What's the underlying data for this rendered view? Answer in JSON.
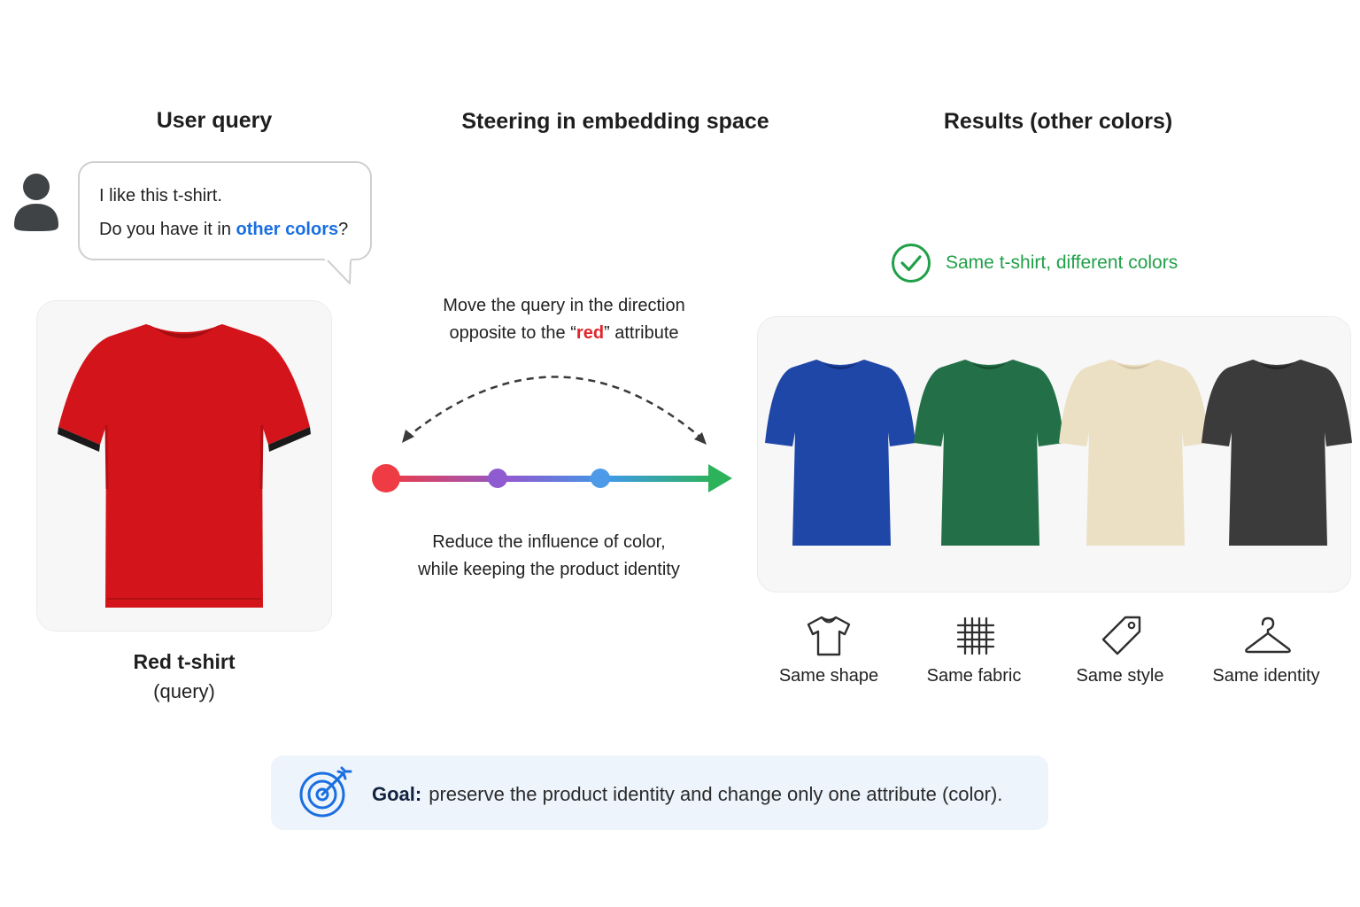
{
  "headers": {
    "query": "User query",
    "steering": "Steering in embedding space",
    "results": "Results (other colors)"
  },
  "bubble": {
    "line1": "I like this t-shirt.",
    "line2_prefix": "Do you have it in ",
    "line2_highlight": "other colors",
    "line2_suffix": "?"
  },
  "query_caption": {
    "title": "Red t-shirt",
    "subtitle": "(query)"
  },
  "steering": {
    "top_line1": "Move the query in the direction",
    "top_line2_prefix": "opposite to the “",
    "top_line2_highlight": "red",
    "top_line2_suffix": "” attribute",
    "bottom_line1": "Reduce the influence of color,",
    "bottom_line2": "while keeping the product identity"
  },
  "results_status": "Same t-shirt, different colors",
  "properties": [
    {
      "label": "Same shape",
      "icon": "tshirt-outline-icon"
    },
    {
      "label": "Same fabric",
      "icon": "fabric-grid-icon"
    },
    {
      "label": "Same style",
      "icon": "tag-icon"
    },
    {
      "label": "Same identity",
      "icon": "hanger-icon"
    }
  ],
  "goal": {
    "label": "Goal:",
    "text": "preserve the product identity and change only one attribute (color)."
  },
  "colors": {
    "query_shirt": "#d3151b",
    "results": [
      "#1f47a8",
      "#237048",
      "#ece0c4",
      "#3b3b3b"
    ],
    "accent_blue": "#1a6fe0",
    "success_green": "#21a048",
    "goal_blue": "#1a6fe0"
  }
}
